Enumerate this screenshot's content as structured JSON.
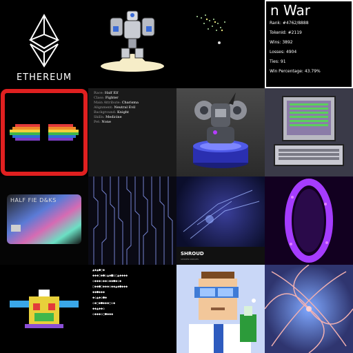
{
  "tiles": {
    "ethereum": {
      "label": "ETHEREUM"
    },
    "war": {
      "title": "n War",
      "lines": [
        "Rank: #4762/8888",
        "TokenId: #2119",
        "Wins: 3892",
        "Losses: 4904",
        "Ties: 91",
        "Win Percentage: 43.79%"
      ]
    },
    "elf": {
      "rows": [
        {
          "key": "Race:",
          "value": "Half Elf"
        },
        {
          "key": "Class:",
          "value": "Fighter"
        },
        {
          "key": "Main Attribute:",
          "value": "Charisma"
        },
        {
          "key": "Alignment:",
          "value": "Neutral Evil"
        },
        {
          "key": "Background:",
          "value": "Knight"
        },
        {
          "key": "Skills:",
          "value": "Medicine"
        },
        {
          "key": "Pet:",
          "value": "None"
        }
      ]
    },
    "card": {
      "label": "HALF FIE D&KS"
    },
    "shroud": {
      "title": "SHROUD",
      "subtitle": "SPOKEN DREAMS"
    },
    "glyphs": {
      "rows": [
        "▲◆▲●▢◆",
        "◆◆◆▢◆●◇▲◆■◇▢▲◆◆◆◆",
        "◇◆◆◆◇◆◆◇◆◆●◆◇◆",
        "▢◆◆●▢◆◆◆◇◆◆▲◆●◆◆◆",
        "◆◆●◆◆◆",
        "◆◇▲◆◇●◆",
        "◇◆▢◆●◆◆◆▢◇◆",
        "◆◆▲◆◆◇",
        "◇◆◆◆◇▢●◆◆◆"
      ]
    }
  }
}
